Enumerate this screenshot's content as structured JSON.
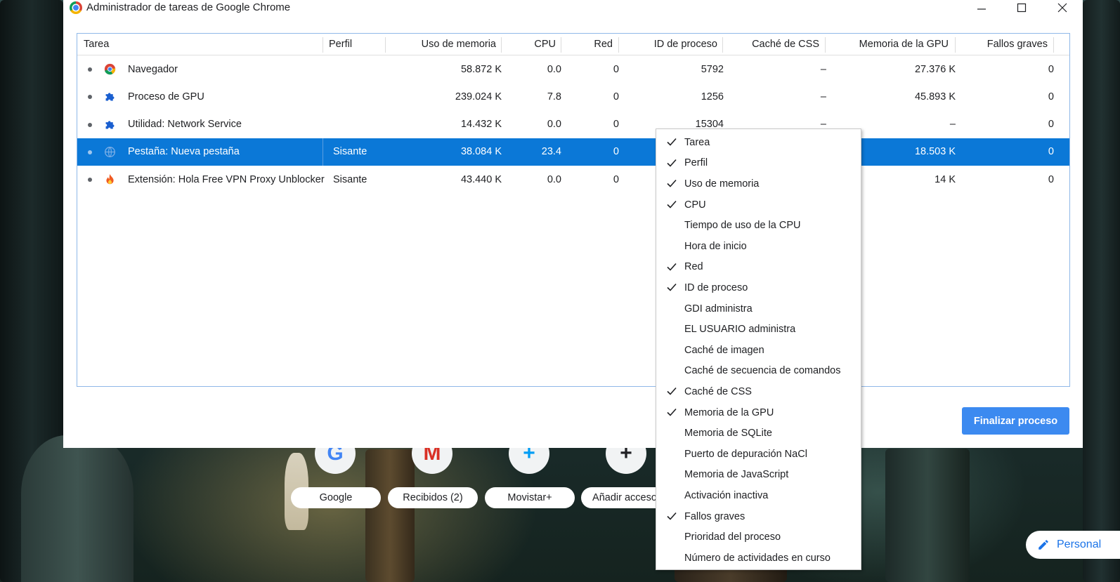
{
  "window": {
    "title": "Administrador de tareas de Google Chrome",
    "controls": {
      "minimize": "—",
      "maximize": "☐",
      "close": "✕"
    }
  },
  "table": {
    "columns": [
      "Tarea",
      "Perfil",
      "Uso de memoria",
      "CPU",
      "Red",
      "ID de proceso",
      "Caché de CSS",
      "Memoria de la GPU",
      "Fallos graves"
    ],
    "rows": [
      {
        "icon": "chrome-icon",
        "task": "Navegador",
        "profile": "",
        "memory": "58.872 K",
        "cpu": "0.0",
        "network": "0",
        "pid": "5792",
        "css_cache": "–",
        "gpu_memory": "27.376 K",
        "hard_faults": "0",
        "selected": false
      },
      {
        "icon": "puzzle-icon",
        "task": "Proceso de GPU",
        "profile": "",
        "memory": "239.024 K",
        "cpu": "7.8",
        "network": "0",
        "pid": "1256",
        "css_cache": "–",
        "gpu_memory": "45.893 K",
        "hard_faults": "0",
        "selected": false
      },
      {
        "icon": "puzzle-icon",
        "task": "Utilidad: Network Service",
        "profile": "",
        "memory": "14.432 K",
        "cpu": "0.0",
        "network": "0",
        "pid": "15304",
        "css_cache": "–",
        "gpu_memory": "–",
        "hard_faults": "0",
        "selected": false
      },
      {
        "icon": "globe-icon",
        "task": "Pestaña: Nueva pestaña",
        "profile": "Sisante",
        "memory": "38.084 K",
        "cpu": "23.4",
        "network": "0",
        "pid": "",
        "css_cache": "",
        "gpu_memory": "18.503 K",
        "hard_faults": "0",
        "selected": true
      },
      {
        "icon": "flame-icon",
        "task": "Extensión: Hola Free VPN Proxy Unblocker",
        "profile": "Sisante",
        "memory": "43.440 K",
        "cpu": "0.0",
        "network": "0",
        "pid": "",
        "css_cache": "",
        "gpu_memory": "14 K",
        "hard_faults": "0",
        "selected": false
      }
    ]
  },
  "finish_button": "Finalizar proceso",
  "context_menu": [
    {
      "label": "Tarea",
      "checked": true
    },
    {
      "label": "Perfil",
      "checked": true
    },
    {
      "label": "Uso de memoria",
      "checked": true
    },
    {
      "label": "CPU",
      "checked": true
    },
    {
      "label": "Tiempo de uso de la CPU",
      "checked": false
    },
    {
      "label": "Hora de inicio",
      "checked": false
    },
    {
      "label": "Red",
      "checked": true
    },
    {
      "label": "ID de proceso",
      "checked": true
    },
    {
      "label": "GDI administra",
      "checked": false
    },
    {
      "label": "EL USUARIO administra",
      "checked": false
    },
    {
      "label": "Caché de imagen",
      "checked": false
    },
    {
      "label": "Caché de secuencia de comandos",
      "checked": false
    },
    {
      "label": "Caché de CSS",
      "checked": true
    },
    {
      "label": "Memoria de la GPU",
      "checked": true
    },
    {
      "label": "Memoria de SQLite",
      "checked": false
    },
    {
      "label": "Puerto de depuración NaCl",
      "checked": false
    },
    {
      "label": "Memoria de JavaScript",
      "checked": false
    },
    {
      "label": "Activación inactiva",
      "checked": false
    },
    {
      "label": "Fallos graves",
      "checked": true
    },
    {
      "label": "Prioridad del proceso",
      "checked": false
    },
    {
      "label": "Número de actividades en curso",
      "checked": false
    }
  ],
  "new_tab": {
    "shortcuts": [
      {
        "label": "Google",
        "icon": "google-icon",
        "glyph": "G",
        "color": "#4285f4"
      },
      {
        "label": "Recibidos (2)",
        "icon": "gmail-icon",
        "glyph": "M",
        "color": "#d93025"
      },
      {
        "label": "Movistar+",
        "icon": "movistar-icon",
        "glyph": "+",
        "color": "#019df4"
      },
      {
        "label": "Añadir acceso.",
        "icon": "add-shortcut-icon",
        "glyph": "+",
        "color": "#202124"
      }
    ],
    "customize_label": "Personal"
  },
  "colors": {
    "selection": "#0b78d7",
    "button": "#3c8af0",
    "frame_border": "#8fb8e8"
  }
}
